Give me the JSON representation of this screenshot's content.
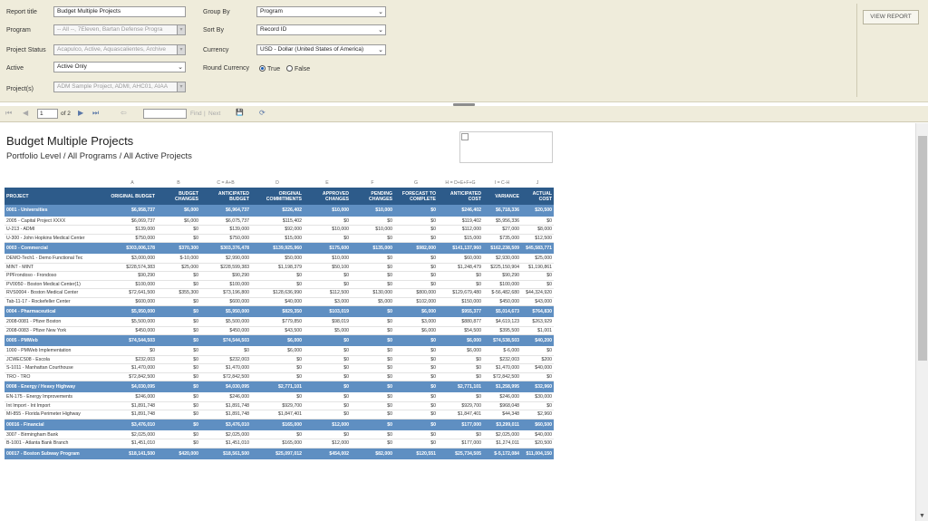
{
  "params": {
    "report_title_label": "Report title",
    "report_title_value": "Budget Multiple Projects",
    "program_label": "Program",
    "program_value": "-- All --, 7Eleven, Bartan Defense Progra",
    "project_status_label": "Project Status",
    "project_status_value": "Acapulco, Active, Aquascalientes, Archive",
    "active_label": "Active",
    "active_value": "Active Only",
    "projects_label": "Project(s)",
    "projects_value": "ADM Sample Project, ADMI, AHC01, AIAA",
    "group_by_label": "Group By",
    "group_by_value": "Program",
    "sort_by_label": "Sort By",
    "sort_by_value": "Record ID",
    "currency_label": "Currency",
    "currency_value": "USD - Dollar (United States of America)",
    "round_label": "Round Currency",
    "round_true": "True",
    "round_false": "False",
    "view_report": "VIEW REPORT"
  },
  "toolbar": {
    "first": "⏮",
    "prev": "◀",
    "page": "1",
    "of_pages": "of 2",
    "next": "▶",
    "last": "⏭",
    "back": "⇦",
    "find": "Find",
    "sep": "|",
    "next_find": "Next",
    "export_icon": "💾",
    "refresh_icon": "⟳"
  },
  "report": {
    "title": "Budget Multiple Projects",
    "subtitle": "Portfolio Level / All Programs / All Active Projects",
    "col_letters": [
      "",
      "A",
      "B",
      "C = A+B",
      "D",
      "E",
      "F",
      "G",
      "H = D+E+F+G",
      "I = C-H",
      "J"
    ],
    "headers": [
      "PROJECT",
      "ORIGINAL BUDGET",
      "BUDGET CHANGES",
      "ANTICIPATED BUDGET",
      "ORIGINAL COMMITMENTS",
      "APPROVED CHANGES",
      "PENDING CHANGES",
      "FORECAST TO COMPLETE",
      "ANTICIPATED COST",
      "VARIANCE",
      "ACTUAL COST"
    ],
    "rows": [
      {
        "type": "grp",
        "cells": [
          "0001 - Universities",
          "$6,958,737",
          "$6,000",
          "$6,964,737",
          "$226,402",
          "$10,000",
          "$10,000",
          "$0",
          "$246,402",
          "$6,718,336",
          "$20,500"
        ]
      },
      {
        "type": "det",
        "cells": [
          "2005 - Capital Project XXXX",
          "$6,069,737",
          "$6,000",
          "$6,075,737",
          "$115,402",
          "$0",
          "$0",
          "$0",
          "$119,402",
          "$5,956,336",
          "$0"
        ]
      },
      {
        "type": "det",
        "cells": [
          "U-213 - ADMI",
          "$139,000",
          "$0",
          "$139,000",
          "$92,000",
          "$10,000",
          "$10,000",
          "$0",
          "$112,000",
          "$27,000",
          "$8,000"
        ]
      },
      {
        "type": "det",
        "cells": [
          "U-300 - John Hopkins Medical Center",
          "$750,000",
          "$0",
          "$750,000",
          "$15,000",
          "$0",
          "$0",
          "$0",
          "$15,000",
          "$735,000",
          "$12,500"
        ]
      },
      {
        "type": "grp",
        "cells": [
          "0003 - Commercial",
          "$303,006,178",
          "$370,300",
          "$303,376,478",
          "$139,925,960",
          "$175,600",
          "$135,000",
          "$982,000",
          "$141,137,960",
          "$162,238,509",
          "$45,583,771"
        ]
      },
      {
        "type": "det",
        "cells": [
          "DEMO-Tech1 - Demo Functional Tec",
          "$3,000,000",
          "$-10,000",
          "$2,990,000",
          "$50,000",
          "$10,000",
          "$0",
          "$0",
          "$60,000",
          "$2,930,000",
          "$25,000"
        ]
      },
      {
        "type": "det",
        "cells": [
          "MINT - MINT",
          "$228,574,383",
          "$25,000",
          "$228,599,383",
          "$1,198,379",
          "$50,100",
          "$0",
          "$0",
          "$1,248,479",
          "$225,150,904",
          "$1,190,861"
        ]
      },
      {
        "type": "det",
        "cells": [
          "PPFrondoso - Frondoso",
          "$90,290",
          "$0",
          "$90,290",
          "$0",
          "$0",
          "$0",
          "$0",
          "$0",
          "$90,290",
          "$0"
        ]
      },
      {
        "type": "det",
        "cells": [
          "PV0050 - Boston Medical Center(1)",
          "$100,000",
          "$0",
          "$100,000",
          "$0",
          "$0",
          "$0",
          "$0",
          "$0",
          "$100,000",
          "$0"
        ]
      },
      {
        "type": "det",
        "cells": [
          "RVS0004 - Boston Medical Center",
          "$72,641,500",
          "$355,300",
          "$73,196,800",
          "$128,636,990",
          "$112,500",
          "$130,000",
          "$800,000",
          "$129,679,480",
          "$-56,482,680",
          "$44,324,920"
        ]
      },
      {
        "type": "det",
        "cells": [
          "Tab-11-17 - Rockefeller Center",
          "$600,000",
          "$0",
          "$600,000",
          "$40,000",
          "$3,000",
          "$5,000",
          "$102,000",
          "$150,000",
          "$450,000",
          "$43,000"
        ]
      },
      {
        "type": "grp",
        "cells": [
          "0004 - Pharmaceutical",
          "$5,950,000",
          "$0",
          "$5,950,000",
          "$829,350",
          "$103,019",
          "$0",
          "$6,000",
          "$955,377",
          "$5,014,673",
          "$764,830"
        ]
      },
      {
        "type": "det",
        "cells": [
          "2008-0081 - Pfizer Boston",
          "$5,500,000",
          "$0",
          "$5,500,000",
          "$779,850",
          "$98,019",
          "$0",
          "$3,000",
          "$880,877",
          "$4,619,123",
          "$263,929"
        ]
      },
      {
        "type": "det",
        "cells": [
          "2008-0083 - Pfizer New York",
          "$450,000",
          "$0",
          "$450,000",
          "$43,500",
          "$5,000",
          "$0",
          "$6,000",
          "$54,500",
          "$395,500",
          "$1,001"
        ]
      },
      {
        "type": "grp",
        "cells": [
          "0005 - PMWeb",
          "$74,544,503",
          "$0",
          "$74,544,503",
          "$6,000",
          "$0",
          "$0",
          "$0",
          "$6,000",
          "$74,538,503",
          "$40,200"
        ]
      },
      {
        "type": "det",
        "cells": [
          "1000 - PMWeb Implementation",
          "$0",
          "$0",
          "$0",
          "$6,000",
          "$0",
          "$0",
          "$0",
          "$6,000",
          "$-6,000",
          "$0"
        ]
      },
      {
        "type": "det",
        "cells": [
          "JCWECS08 - Escola",
          "$232,003",
          "$0",
          "$232,003",
          "$0",
          "$0",
          "$0",
          "$0",
          "$0",
          "$232,003",
          "$200"
        ]
      },
      {
        "type": "det",
        "cells": [
          "S-1011 - Manhattan Courthouse",
          "$1,470,000",
          "$0",
          "$1,470,000",
          "$0",
          "$0",
          "$0",
          "$0",
          "$0",
          "$1,470,000",
          "$40,000"
        ]
      },
      {
        "type": "det",
        "cells": [
          "TRO - TRO",
          "$72,842,500",
          "$0",
          "$72,842,500",
          "$0",
          "$0",
          "$0",
          "$0",
          "$0",
          "$72,842,500",
          "$0"
        ]
      },
      {
        "type": "grp",
        "cells": [
          "0008 - Energy / Heavy Highway",
          "$4,030,095",
          "$0",
          "$4,030,095",
          "$2,771,101",
          "$0",
          "$0",
          "$0",
          "$2,771,101",
          "$1,258,995",
          "$32,960"
        ]
      },
      {
        "type": "det",
        "cells": [
          "EN-175 - Energy Improvements",
          "$246,000",
          "$0",
          "$246,000",
          "$0",
          "$0",
          "$0",
          "$0",
          "$0",
          "$246,000",
          "$30,000"
        ]
      },
      {
        "type": "det",
        "cells": [
          "Int Import - Int Import",
          "$1,891,748",
          "$0",
          "$1,891,748",
          "$929,700",
          "$0",
          "$0",
          "$0",
          "$929,700",
          "$968,048",
          "$0"
        ]
      },
      {
        "type": "det",
        "cells": [
          "MI-855 - Florida Perimeter Highway",
          "$1,891,748",
          "$0",
          "$1,891,748",
          "$1,847,401",
          "$0",
          "$0",
          "$0",
          "$1,847,401",
          "$44,348",
          "$2,960"
        ]
      },
      {
        "type": "grp",
        "cells": [
          "00016 - Financial",
          "$3,476,010",
          "$0",
          "$3,476,010",
          "$165,000",
          "$12,000",
          "$0",
          "$0",
          "$177,000",
          "$3,299,011",
          "$60,500"
        ]
      },
      {
        "type": "det",
        "cells": [
          "3007 - Birmingham Bank",
          "$2,025,000",
          "$0",
          "$2,025,000",
          "$0",
          "$0",
          "$0",
          "$0",
          "$0",
          "$2,025,000",
          "$40,000"
        ]
      },
      {
        "type": "det",
        "cells": [
          "B-1001 - Atlanta Bank Branch",
          "$1,451,010",
          "$0",
          "$1,451,010",
          "$165,000",
          "$12,000",
          "$0",
          "$0",
          "$177,000",
          "$1,274,011",
          "$20,500"
        ]
      },
      {
        "type": "grp",
        "cells": [
          "00017 - Boston Subway Program",
          "$18,141,500",
          "$420,000",
          "$18,561,500",
          "$25,097,012",
          "$454,002",
          "$82,000",
          "$120,551",
          "$25,734,505",
          "$-5,172,084",
          "$11,004,150"
        ]
      }
    ]
  },
  "colors": {
    "header": "#2d5b8a",
    "group_row": "#5f8fc2",
    "panel": "#efecdb"
  }
}
